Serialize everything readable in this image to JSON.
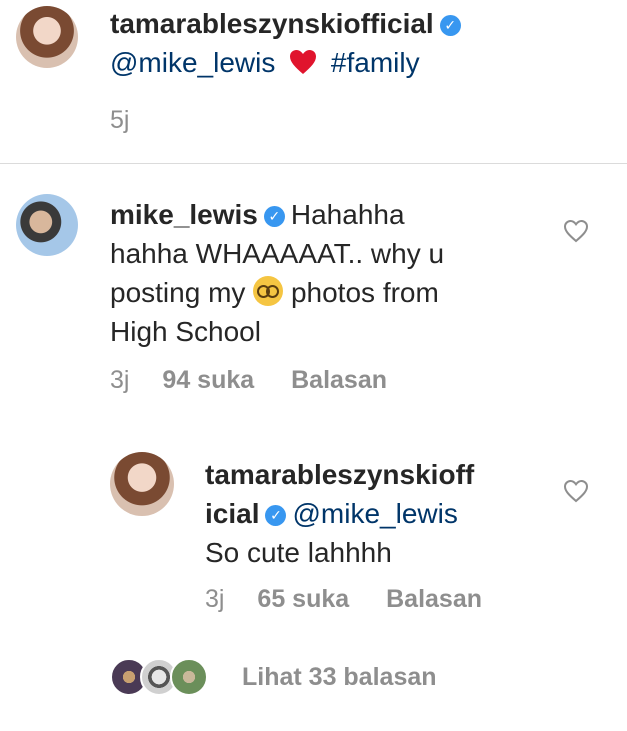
{
  "caption": {
    "username": "tamarableszynskiofficial",
    "mention": "@mike_lewis",
    "emoji": "❤️",
    "hashtag": "#family",
    "time": "5j"
  },
  "comments": [
    {
      "username": "mike_lewis",
      "text_line1": "Hahahha",
      "text_line2": "hahha WHAAAAAT.. why u",
      "text_line3_a": "posting my",
      "text_line3_b": "photos from",
      "text_line4": "High School",
      "emoji_icon": "nerd-face-emoji",
      "time": "3j",
      "likes": "94 suka",
      "reply_label": "Balasan"
    }
  ],
  "reply": {
    "username_line1": "tamarableszynskioff",
    "username_line2": "icial",
    "mention": "@mike_lewis",
    "text": "So cute lahhhh",
    "time": "3j",
    "likes": "65 suka",
    "reply_label": "Balasan"
  },
  "view_replies": {
    "label": "Lihat 33 balasan"
  },
  "colors": {
    "link": "#003569",
    "verified": "#3897f0",
    "meta": "#8e8e8e",
    "heart": "#ed4956"
  }
}
